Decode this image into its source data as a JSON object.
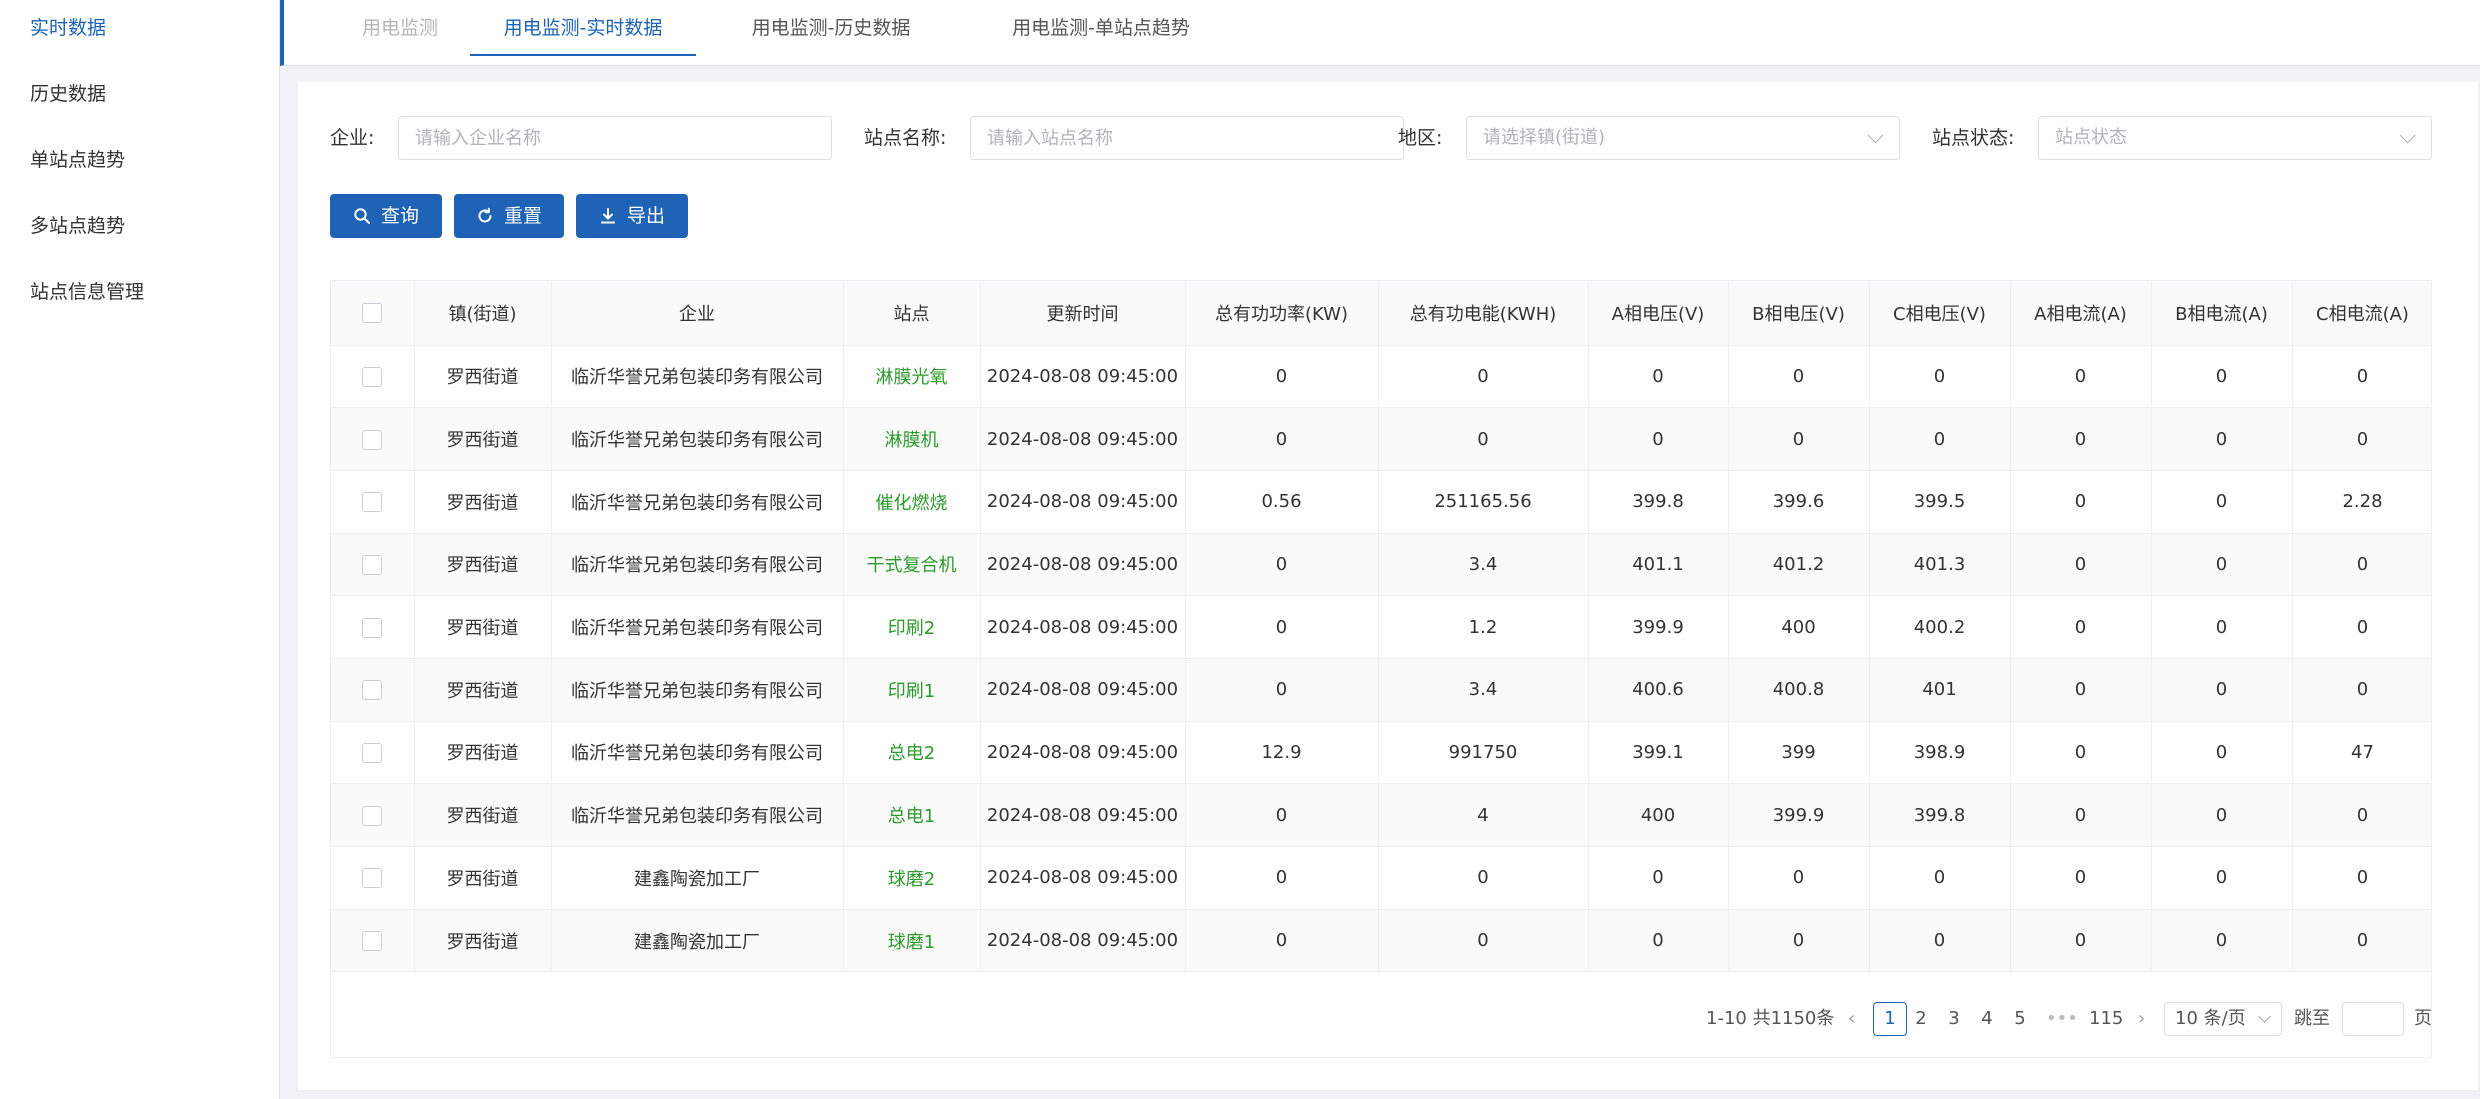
{
  "sidebar": {
    "items": [
      {
        "label": "实时数据",
        "active": true
      },
      {
        "label": "历史数据",
        "active": false
      },
      {
        "label": "单站点趋势",
        "active": false
      },
      {
        "label": "多站点趋势",
        "active": false
      },
      {
        "label": "站点信息管理",
        "active": false
      }
    ]
  },
  "tabs": [
    {
      "label": "用电监测",
      "state": "disabled"
    },
    {
      "label": "用电监测-实时数据",
      "state": "active"
    },
    {
      "label": "用电监测-历史数据",
      "state": "normal"
    },
    {
      "label": "用电监测-单站点趋势",
      "state": "normal"
    }
  ],
  "filters": {
    "company_label": "企业:",
    "company_placeholder": "请输入企业名称",
    "station_label": "站点名称:",
    "station_placeholder": "请输入站点名称",
    "region_label": "地区:",
    "region_placeholder": "请选择镇(街道)",
    "status_label": "站点状态:",
    "status_placeholder": "站点状态"
  },
  "buttons": {
    "query": "查询",
    "reset": "重置",
    "export": "导出"
  },
  "table": {
    "headers": [
      "镇(街道)",
      "企业",
      "站点",
      "更新时间",
      "总有功功率(KW)",
      "总有功电能(KWH)",
      "A相电压(V)",
      "B相电压(V)",
      "C相电压(V)",
      "A相电流(A)",
      "B相电流(A)",
      "C相电流(A)"
    ],
    "rows": [
      [
        "罗西街道",
        "临沂华誉兄弟包装印务有限公司",
        "淋膜光氧",
        "2024-08-08 09:45:00",
        "0",
        "0",
        "0",
        "0",
        "0",
        "0",
        "0",
        "0"
      ],
      [
        "罗西街道",
        "临沂华誉兄弟包装印务有限公司",
        "淋膜机",
        "2024-08-08 09:45:00",
        "0",
        "0",
        "0",
        "0",
        "0",
        "0",
        "0",
        "0"
      ],
      [
        "罗西街道",
        "临沂华誉兄弟包装印务有限公司",
        "催化燃烧",
        "2024-08-08 09:45:00",
        "0.56",
        "251165.56",
        "399.8",
        "399.6",
        "399.5",
        "0",
        "0",
        "2.28"
      ],
      [
        "罗西街道",
        "临沂华誉兄弟包装印务有限公司",
        "干式复合机",
        "2024-08-08 09:45:00",
        "0",
        "3.4",
        "401.1",
        "401.2",
        "401.3",
        "0",
        "0",
        "0"
      ],
      [
        "罗西街道",
        "临沂华誉兄弟包装印务有限公司",
        "印刷2",
        "2024-08-08 09:45:00",
        "0",
        "1.2",
        "399.9",
        "400",
        "400.2",
        "0",
        "0",
        "0"
      ],
      [
        "罗西街道",
        "临沂华誉兄弟包装印务有限公司",
        "印刷1",
        "2024-08-08 09:45:00",
        "0",
        "3.4",
        "400.6",
        "400.8",
        "401",
        "0",
        "0",
        "0"
      ],
      [
        "罗西街道",
        "临沂华誉兄弟包装印务有限公司",
        "总电2",
        "2024-08-08 09:45:00",
        "12.9",
        "991750",
        "399.1",
        "399",
        "398.9",
        "0",
        "0",
        "47"
      ],
      [
        "罗西街道",
        "临沂华誉兄弟包装印务有限公司",
        "总电1",
        "2024-08-08 09:45:00",
        "0",
        "4",
        "400",
        "399.9",
        "399.8",
        "0",
        "0",
        "0"
      ],
      [
        "罗西街道",
        "建鑫陶瓷加工厂",
        "球磨2",
        "2024-08-08 09:45:00",
        "0",
        "0",
        "0",
        "0",
        "0",
        "0",
        "0",
        "0"
      ],
      [
        "罗西街道",
        "建鑫陶瓷加工厂",
        "球磨1",
        "2024-08-08 09:45:00",
        "0",
        "0",
        "0",
        "0",
        "0",
        "0",
        "0",
        "0"
      ]
    ]
  },
  "pagination": {
    "summary": "1-10 共1150条",
    "pages": [
      "1",
      "2",
      "3",
      "4",
      "5"
    ],
    "current": "1",
    "ellipsis": "•••",
    "last": "115",
    "page_size": "10 条/页",
    "jump_label": "跳至",
    "page_suffix": "页"
  },
  "colors": {
    "primary": "#1e63b5",
    "station_text": "#2c9a2c"
  }
}
